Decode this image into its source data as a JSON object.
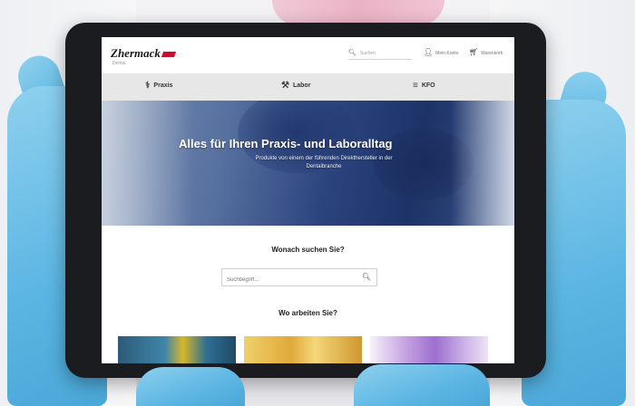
{
  "header": {
    "logo": "Zhermack",
    "logo_sub": "Dental",
    "search_placeholder": "Suchen",
    "account_label": "Mein Konto",
    "cart_label": "Warenkorb"
  },
  "nav": {
    "items": [
      {
        "label": "Praxis",
        "icon": "tooth-icon"
      },
      {
        "label": "Labor",
        "icon": "dental-tool-icon"
      },
      {
        "label": "KFO",
        "icon": "braces-icon"
      }
    ]
  },
  "hero": {
    "title": "Alles für Ihren Praxis- und Laboralltag",
    "subtitle": "Produkte von einem der führenden Direkthersteller in der Dentalbranche"
  },
  "search_section": {
    "title": "Wonach suchen Sie?",
    "placeholder": "Suchbegriff..."
  },
  "workplace_section": {
    "title": "Wo arbeiten Sie?"
  },
  "colors": {
    "brand_red": "#c8102e",
    "nav_bg": "#e7e7e7",
    "glove_blue": "#5cb6e3"
  }
}
